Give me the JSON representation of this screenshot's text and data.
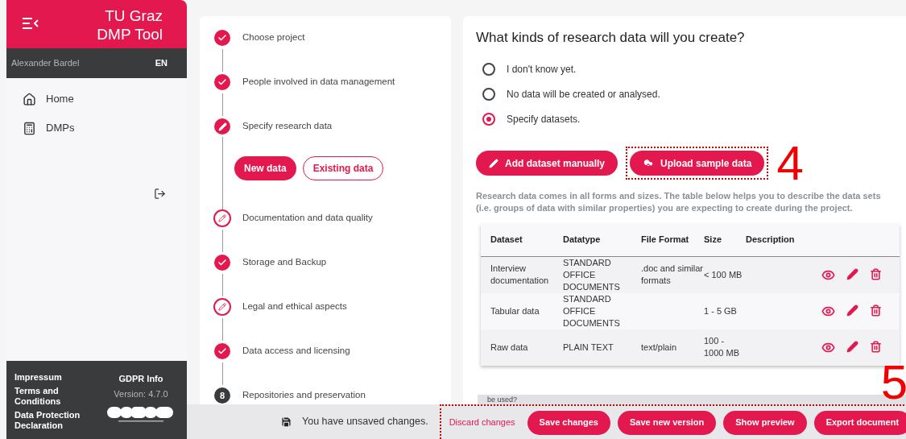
{
  "sidebar": {
    "title": "TU Graz DMP Tool",
    "user": "Alexander Bardel",
    "language": "EN",
    "nav": [
      {
        "label": "Home",
        "kind": "home"
      },
      {
        "label": "DMPs",
        "kind": "dmps"
      }
    ],
    "footer": {
      "links": [
        "Impressum",
        "Terms and Conditions",
        "Data Protection Declaration"
      ],
      "gdpr": "GDPR Info",
      "version": "Version: 4.7.0"
    }
  },
  "steps": [
    {
      "label": "Choose project",
      "kind": "done"
    },
    {
      "label": "People involved in data management",
      "kind": "done"
    },
    {
      "label": "Specify research data",
      "kind": "current",
      "substeps": [
        {
          "label": "New data",
          "selected": true
        },
        {
          "label": "Existing data",
          "selected": false
        }
      ]
    },
    {
      "label": "Documentation and data quality",
      "kind": "edit"
    },
    {
      "label": "Storage and Backup",
      "kind": "done"
    },
    {
      "label": "Legal and ethical aspects",
      "kind": "edit"
    },
    {
      "label": "Data access and licensing",
      "kind": "done"
    },
    {
      "label": "Repositories and preservation",
      "kind": "number",
      "number": "8"
    }
  ],
  "question": {
    "title": "What kinds of research data will you create?",
    "options": [
      {
        "label": "I don't know yet.",
        "selected": false
      },
      {
        "label": "No data will be created or analysed.",
        "selected": false
      },
      {
        "label": "Specify datasets.",
        "selected": true
      }
    ],
    "actions": [
      {
        "label": "Add dataset manually",
        "kind": "pencil"
      },
      {
        "label": "Upload sample data",
        "kind": "upload",
        "callout": "4"
      }
    ],
    "help": "Research data comes in all forms and sizes. The table below helps you to describe the data sets (i.e. groups of data with similar properties) you are expecting to create during the project.",
    "table": {
      "columns": [
        "Dataset",
        "Datatype",
        "File Format",
        "Size",
        "Description"
      ],
      "rows": [
        [
          "Interview documentation",
          "STANDARD OFFICE DOCUMENTS",
          ".doc and similar formats",
          "< 100 MB",
          ""
        ],
        [
          "Tabular data",
          "STANDARD OFFICE DOCUMENTS",
          "",
          "1 - 5 GB",
          ""
        ],
        [
          "Raw data",
          "PLAIN TEXT",
          "text/plain",
          "100 - 1000 MB",
          ""
        ]
      ]
    },
    "next_text": "be used?"
  },
  "bottom_bar": {
    "message": "You have unsaved changes.",
    "discard": "Discard changes",
    "buttons": [
      "Save changes",
      "Save new version",
      "Show preview",
      "Export document"
    ],
    "callout": "5"
  }
}
